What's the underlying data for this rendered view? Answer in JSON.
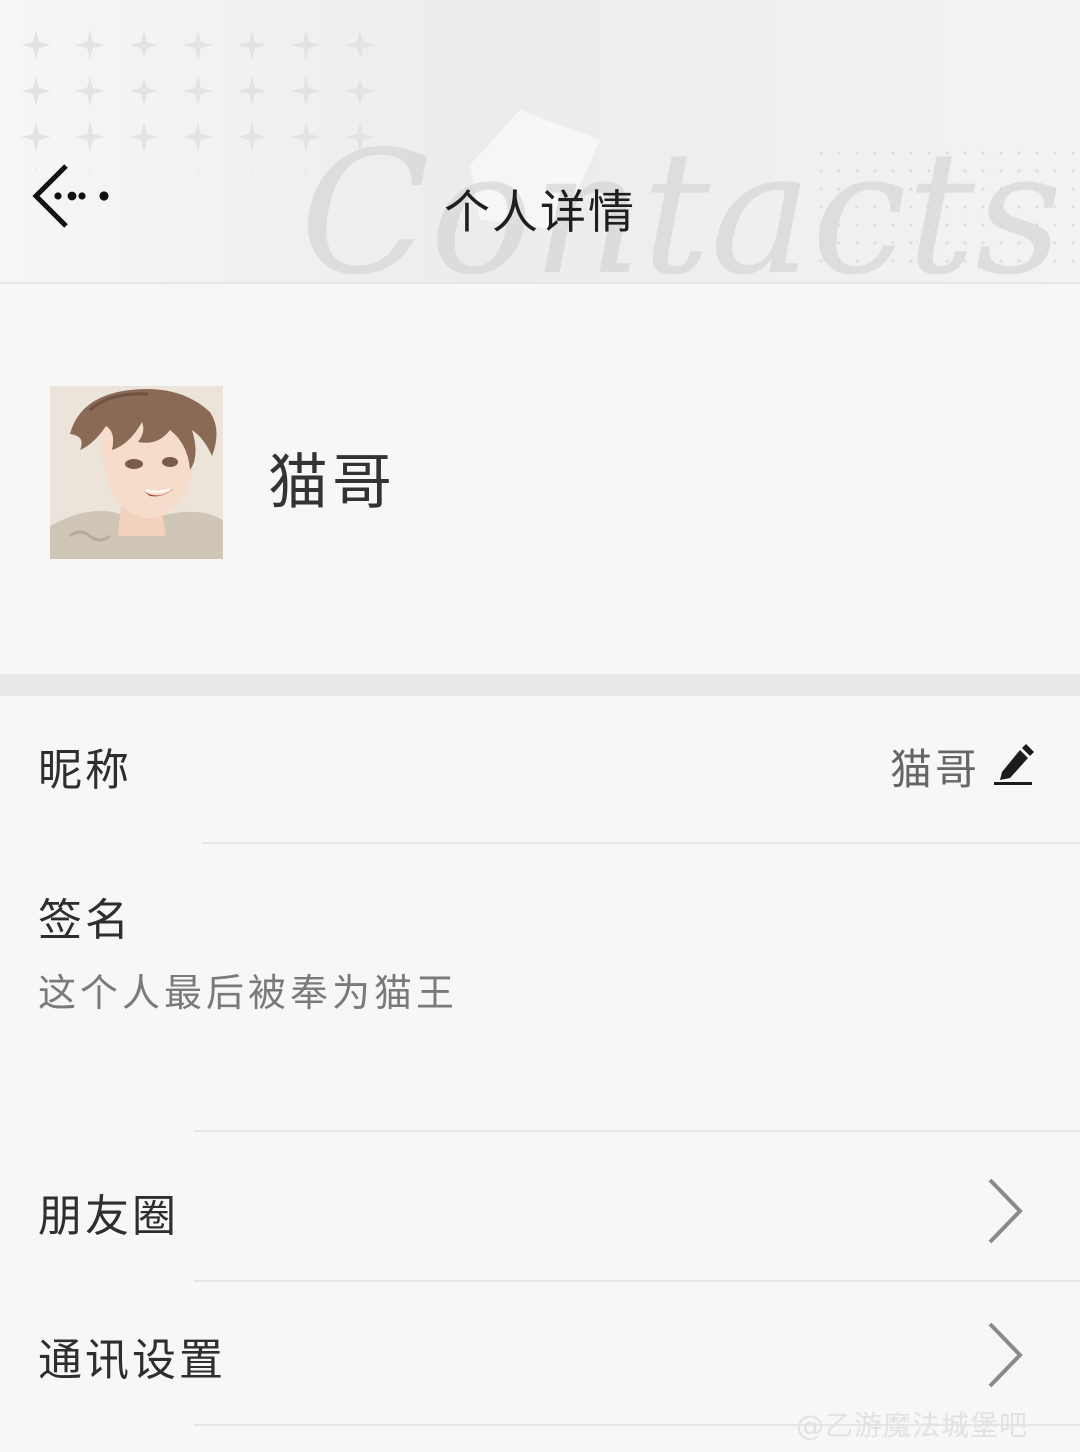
{
  "header": {
    "title": "个人详情",
    "background_script_text": "Contacts"
  },
  "profile": {
    "name": "猫哥"
  },
  "nickname": {
    "label": "昵称",
    "value": "猫哥"
  },
  "signature": {
    "label": "签名",
    "value": "这个人最后被奉为猫王"
  },
  "moments": {
    "label": "朋友圈"
  },
  "comm_settings": {
    "label": "通讯设置"
  },
  "watermark": {
    "text": "@乙游魔法城堡吧"
  },
  "icons": {
    "back": "back-arrow-icon",
    "edit": "pencil-icon",
    "chevron": "chevron-right-icon"
  }
}
